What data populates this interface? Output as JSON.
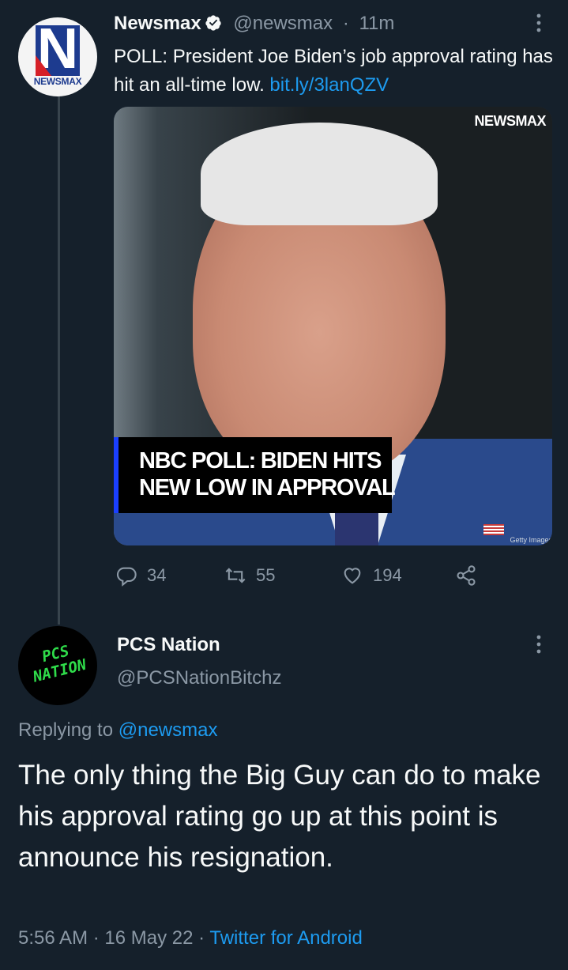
{
  "quoted_tweet": {
    "author_name": "Newsmax",
    "author_handle": "@newsmax",
    "separator": "·",
    "time": "11m",
    "text_prefix": "POLL: President Joe Biden’s job approval rating has hit an all-time low.",
    "link": "bit.ly/3lanQZV",
    "avatar_wordmark": "NEWSMAX",
    "avatar_letter": "N",
    "media": {
      "watermark": "NEWSMAX",
      "headline_line1": "NBC POLL: BIDEN HITS",
      "headline_line2": "NEW LOW IN APPROVAL",
      "credit": "Getty Images"
    },
    "actions": {
      "replies": "34",
      "retweets": "55",
      "likes": "194"
    },
    "more_icon": "more-vertical-icon"
  },
  "reply_tweet": {
    "author_name": "PCS Nation",
    "author_handle": "@PCSNationBitchz",
    "avatar_text_line1": "PCS",
    "avatar_text_line2": "NATION",
    "replying_to_label": "Replying to",
    "replying_to_handle": "@newsmax",
    "text": "The only thing the Big Guy can do to make his approval rating go up at this point is announce his resignation.",
    "time": "5:56 AM",
    "date": "16 May 22",
    "separator": "·",
    "source": "Twitter for Android",
    "more_icon": "more-vertical-icon"
  },
  "colors": {
    "background": "#15202b",
    "text": "#f7f9f9",
    "muted": "#8b98a5",
    "link": "#1d9bf0",
    "thread_line": "#38444d",
    "pcs_green": "#2fdc4a"
  }
}
